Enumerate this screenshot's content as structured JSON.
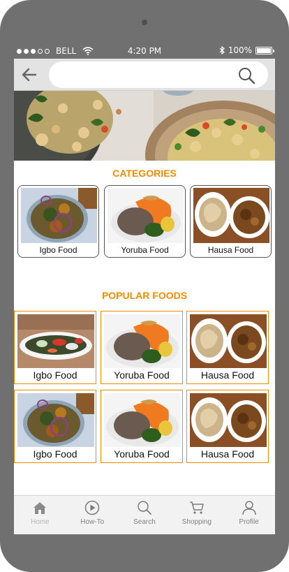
{
  "status": {
    "carrier": "BELL",
    "time": "4:20 PM",
    "battery": "100%",
    "battery_level": 1.0,
    "signal_dots_filled": 3,
    "signal_dots_total": 5
  },
  "search": {
    "placeholder": "",
    "value": ""
  },
  "sections": {
    "categories_title": "CATEGORIES",
    "popular_title": "POPULAR FOODS"
  },
  "categories": [
    {
      "label": "Igbo Food"
    },
    {
      "label": "Yoruba Food"
    },
    {
      "label": "Hausa Food"
    }
  ],
  "popular_foods": [
    {
      "label": "Igbo Food"
    },
    {
      "label": "Yoruba Food"
    },
    {
      "label": "Hausa Food"
    },
    {
      "label": "Igbo Food"
    },
    {
      "label": "Yoruba Food"
    },
    {
      "label": "Hausa Food"
    }
  ],
  "tabbar": [
    {
      "label": "Home",
      "icon": "home-icon",
      "active": true
    },
    {
      "label": "How-To",
      "icon": "play-icon",
      "active": false
    },
    {
      "label": "Search",
      "icon": "search-icon",
      "active": false
    },
    {
      "label": "Shopping",
      "icon": "cart-icon",
      "active": false
    },
    {
      "label": "Profile",
      "icon": "profile-icon",
      "active": false
    }
  ],
  "colors": {
    "accent": "#f08c00",
    "device_frame": "#707070",
    "tab_inactive": "#808080",
    "tab_active": "#b5b5b5"
  }
}
